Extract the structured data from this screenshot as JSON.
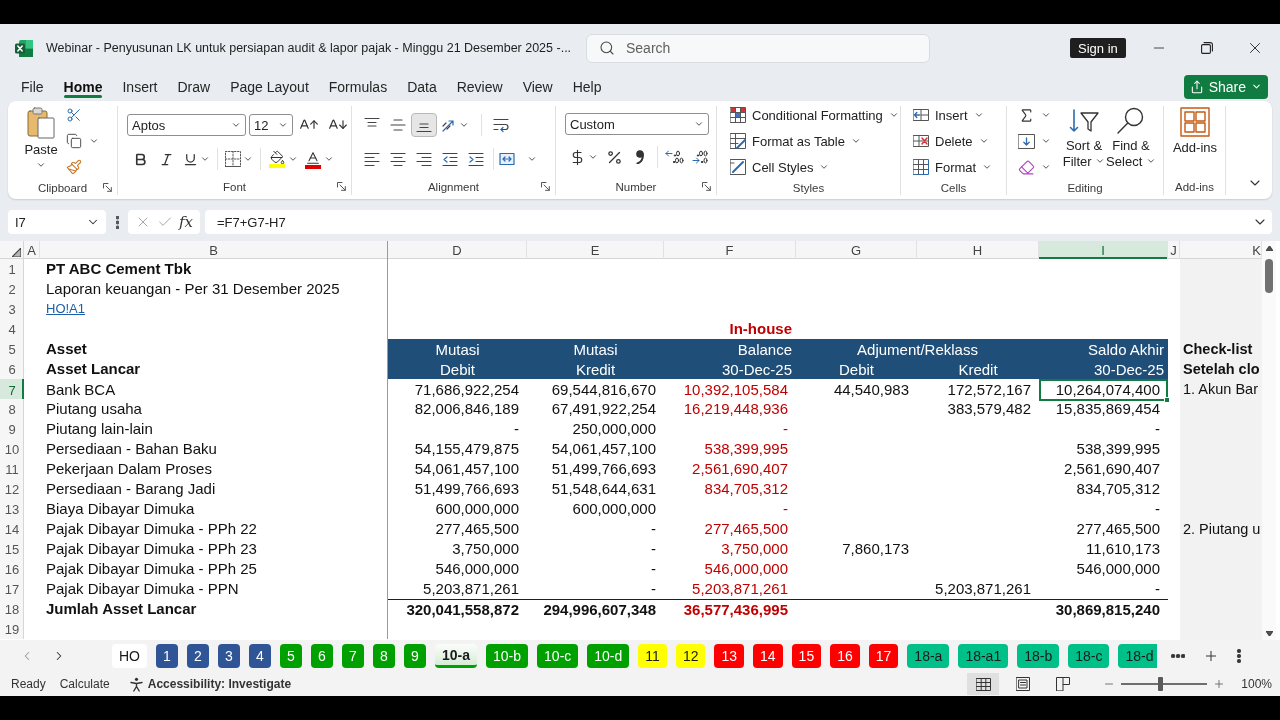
{
  "window": {
    "title": "Webinar - Penyusunan LK untuk persiapan audit & lapor pajak - Minggu 21 Desember 2025 -...",
    "search": {
      "placeholder": "Search"
    },
    "sign_in": "Sign in"
  },
  "menu": {
    "tabs": [
      {
        "label": "File",
        "selected": false
      },
      {
        "label": "Home",
        "selected": true
      },
      {
        "label": "Insert",
        "selected": false
      },
      {
        "label": "Draw",
        "selected": false
      },
      {
        "label": "Page Layout",
        "selected": false
      },
      {
        "label": "Formulas",
        "selected": false
      },
      {
        "label": "Data",
        "selected": false
      },
      {
        "label": "Review",
        "selected": false
      },
      {
        "label": "View",
        "selected": false
      },
      {
        "label": "Help",
        "selected": false
      }
    ],
    "share": "Share"
  },
  "ribbon": {
    "groups": [
      {
        "kind": "clipboard",
        "label": "Clipboard",
        "paste": "Paste"
      },
      {
        "kind": "font",
        "label": "Font",
        "font_name": "Aptos",
        "font_size": "12"
      },
      {
        "kind": "alignment",
        "label": "Alignment",
        "vertical": [
          {
            "kind": "top",
            "selected": false
          },
          {
            "kind": "middle",
            "selected": false
          },
          {
            "kind": "bottom",
            "selected": true
          }
        ]
      },
      {
        "kind": "number",
        "label": "Number",
        "format": "Custom"
      },
      {
        "kind": "styles",
        "label": "Styles",
        "items": [
          {
            "kind": "conditional",
            "label": "Conditional Formatting"
          },
          {
            "kind": "table",
            "label": "Format as Table"
          },
          {
            "kind": "cell_styles",
            "label": "Cell Styles"
          }
        ]
      },
      {
        "kind": "cells",
        "label": "Cells",
        "items": [
          {
            "kind": "insert",
            "label": "Insert"
          },
          {
            "kind": "delete",
            "label": "Delete"
          },
          {
            "kind": "format",
            "label": "Format"
          }
        ]
      },
      {
        "kind": "editing",
        "label": "Editing",
        "sort": "Sort & Filter",
        "find": "Find & Select"
      },
      {
        "kind": "addins",
        "label": "Add-ins",
        "button": "Add-ins"
      }
    ]
  },
  "formula_bar": {
    "name_box": "I7",
    "function_label": "fx",
    "formula": "=F7+G7-H7"
  },
  "sheet": {
    "columns": [
      {
        "label": "A",
        "selected": false
      },
      {
        "label": "B",
        "selected": false
      },
      {
        "label": "D",
        "selected": false
      },
      {
        "label": "E",
        "selected": false
      },
      {
        "label": "F",
        "selected": false
      },
      {
        "label": "G",
        "selected": false
      },
      {
        "label": "H",
        "selected": false
      },
      {
        "label": "I",
        "selected": true
      },
      {
        "label": "J",
        "selected": false
      },
      {
        "label": "K",
        "selected": false
      }
    ],
    "rows": [
      {
        "number": "1",
        "selected": false,
        "kind": "title",
        "label": "PT ABC Cement Tbk"
      },
      {
        "number": "2",
        "selected": false,
        "kind": "text",
        "label": "Laporan keuangan - Per 31 Desember 2025"
      },
      {
        "number": "3",
        "selected": false,
        "kind": "link",
        "label": "HO!A1"
      },
      {
        "number": "4",
        "selected": false,
        "kind": "caption",
        "cells": {
          "f": "In-house"
        }
      },
      {
        "number": "5",
        "selected": false,
        "kind": "band_head",
        "label": "Asset",
        "cells": {
          "d": "Mutasi",
          "e": "Mutasi",
          "f": "Balance",
          "g_h": "Adjument/Reklass",
          "i": "Saldo Akhir"
        },
        "note": "Check-list"
      },
      {
        "number": "6",
        "selected": false,
        "kind": "band",
        "label": "Asset Lancar",
        "cells": {
          "d": "Debit",
          "e": "Kredit",
          "f": "30-Dec-25",
          "g": "Debit",
          "h": "Kredit",
          "i": "30-Dec-25"
        },
        "note": "Setelah clo"
      },
      {
        "number": "7",
        "selected": true,
        "kind": "data",
        "label": "Bank BCA",
        "cells": {
          "d": "71,686,922,254",
          "e": "69,544,816,670",
          "f": "10,392,105,584",
          "g": "44,540,983",
          "h": "172,572,167",
          "i": "10,264,074,400"
        },
        "note": "1. Akun Bar"
      },
      {
        "number": "8",
        "selected": false,
        "kind": "data",
        "label": "Piutang usaha",
        "cells": {
          "d": "82,006,846,189",
          "e": "67,491,922,254",
          "f": "16,219,448,936",
          "h": "383,579,482",
          "i": "15,835,869,454"
        }
      },
      {
        "number": "9",
        "selected": false,
        "kind": "data",
        "label": "Piutang lain-lain",
        "cells": {
          "d": "-",
          "e": "250,000,000",
          "f": "-",
          "i": "-"
        }
      },
      {
        "number": "10",
        "selected": false,
        "kind": "data",
        "label": "Persediaan - Bahan Baku",
        "cells": {
          "d": "54,155,479,875",
          "e": "54,061,457,100",
          "f": "538,399,995",
          "i": "538,399,995"
        }
      },
      {
        "number": "11",
        "selected": false,
        "kind": "data",
        "label": "Pekerjaan Dalam Proses",
        "cells": {
          "d": "54,061,457,100",
          "e": "51,499,766,693",
          "f": "2,561,690,407",
          "i": "2,561,690,407"
        }
      },
      {
        "number": "12",
        "selected": false,
        "kind": "data",
        "label": "Persediaan - Barang Jadi",
        "cells": {
          "d": "51,499,766,693",
          "e": "51,548,644,631",
          "f": "834,705,312",
          "i": "834,705,312"
        }
      },
      {
        "number": "13",
        "selected": false,
        "kind": "data",
        "label": "Biaya Dibayar Dimuka",
        "cells": {
          "d": "600,000,000",
          "e": "600,000,000",
          "f": "-",
          "i": "-"
        }
      },
      {
        "number": "14",
        "selected": false,
        "kind": "data",
        "label": "Pajak Dibayar Dimuka - PPh 22",
        "cells": {
          "d": "277,465,500",
          "e": "-",
          "f": "277,465,500",
          "i": "277,465,500"
        },
        "note": "2. Piutang u"
      },
      {
        "number": "15",
        "selected": false,
        "kind": "data",
        "label": "Pajak Dibayar Dimuka - PPh 23",
        "cells": {
          "d": "3,750,000",
          "e": "-",
          "f": "3,750,000",
          "g": "7,860,173",
          "i": "11,610,173"
        }
      },
      {
        "number": "16",
        "selected": false,
        "kind": "data",
        "label": "Pajak Dibayar Dimuka - PPh 25",
        "cells": {
          "d": "546,000,000",
          "e": "-",
          "f": "546,000,000",
          "i": "546,000,000"
        }
      },
      {
        "number": "17",
        "selected": false,
        "kind": "data",
        "label": "Pajak Dibayar Dimuka - PPN",
        "cells": {
          "d": "5,203,871,261",
          "e": "-",
          "f": "5,203,871,261",
          "h": "5,203,871,261",
          "i": "-"
        }
      },
      {
        "number": "18",
        "selected": false,
        "kind": "total",
        "label": "Jumlah Asset Lancar",
        "cells": {
          "d": "320,041,558,872",
          "e": "294,996,607,348",
          "f": "36,577,436,995",
          "i": "30,869,815,240"
        }
      },
      {
        "number": "19",
        "selected": false,
        "kind": "blank"
      }
    ]
  },
  "sheet_tabs": [
    {
      "label": "HO",
      "color": "#ffffff",
      "selected": false
    },
    {
      "label": "1",
      "color": "#2f5597",
      "selected": false
    },
    {
      "label": "2",
      "color": "#2f5597",
      "selected": false
    },
    {
      "label": "3",
      "color": "#2f5597",
      "selected": false
    },
    {
      "label": "4",
      "color": "#2f5597",
      "selected": false
    },
    {
      "label": "5",
      "color": "#00a000",
      "selected": false
    },
    {
      "label": "6",
      "color": "#00a000",
      "selected": false
    },
    {
      "label": "7",
      "color": "#00a000",
      "selected": false
    },
    {
      "label": "8",
      "color": "#00a000",
      "selected": false
    },
    {
      "label": "9",
      "color": "#00a000",
      "selected": false
    },
    {
      "label": "10-a",
      "color": "#00a000",
      "selected": true
    },
    {
      "label": "10-b",
      "color": "#00a000",
      "selected": false
    },
    {
      "label": "10-c",
      "color": "#00a000",
      "selected": false
    },
    {
      "label": "10-d",
      "color": "#00a000",
      "selected": false
    },
    {
      "label": "11",
      "color": "#ffff00",
      "selected": false
    },
    {
      "label": "12",
      "color": "#ffff00",
      "selected": false
    },
    {
      "label": "13",
      "color": "#ff0000",
      "selected": false
    },
    {
      "label": "14",
      "color": "#ff0000",
      "selected": false
    },
    {
      "label": "15",
      "color": "#ff0000",
      "selected": false
    },
    {
      "label": "16",
      "color": "#ff0000",
      "selected": false
    },
    {
      "label": "17",
      "color": "#ff0000",
      "selected": false
    },
    {
      "label": "18-a",
      "color": "#00c08a",
      "selected": false
    },
    {
      "label": "18-a1",
      "color": "#00c08a",
      "selected": false
    },
    {
      "label": "18-b",
      "color": "#00c08a",
      "selected": false
    },
    {
      "label": "18-c",
      "color": "#00c08a",
      "selected": false
    },
    {
      "label": "18-d",
      "color": "#00c08a",
      "selected": false
    }
  ],
  "status_bar": {
    "mode": "Ready",
    "calculate": "Calculate",
    "accessibility": "Accessibility: Investigate",
    "views": [
      {
        "kind": "normal",
        "selected": true
      },
      {
        "kind": "page_layout",
        "selected": false
      },
      {
        "kind": "page_break",
        "selected": false
      }
    ],
    "zoom": {
      "level": 0.45,
      "reading": "100%"
    }
  }
}
